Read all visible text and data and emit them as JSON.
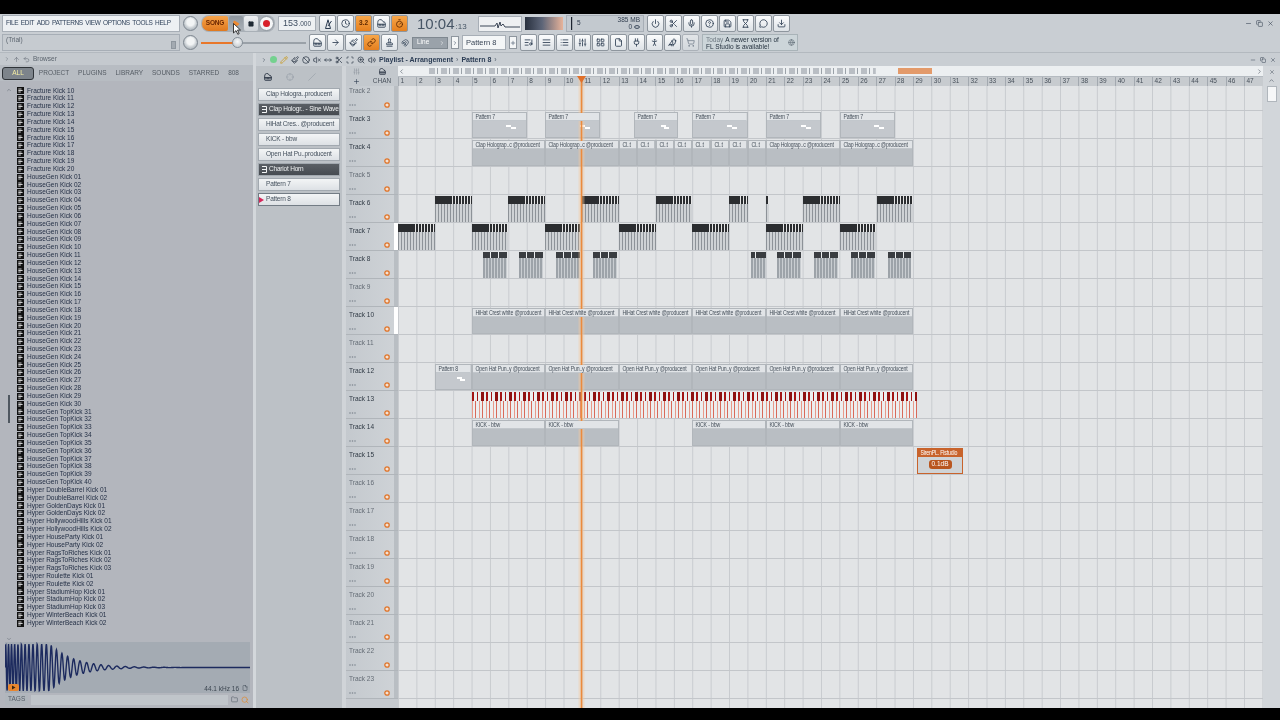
{
  "menu": [
    "FILE",
    "EDIT",
    "ADD",
    "PATTERNS",
    "VIEW",
    "OPTIONS",
    "TOOLS",
    "HELP"
  ],
  "hint_bar": {
    "text": "(Trial)"
  },
  "transport": {
    "mode": {
      "label": "SONG",
      "on": true
    },
    "playing": true,
    "tempo": "153",
    "tempo_decimals": ".000"
  },
  "record_options": [
    {
      "on": false
    },
    {
      "on": false
    },
    {
      "label": "3.2",
      "on": true
    },
    {
      "on": false
    },
    {
      "on": true
    }
  ],
  "clock": {
    "time": "10:04",
    "seconds": ":13"
  },
  "monitor": {
    "cpu": "5",
    "memory": "385 MB",
    "voices": "0"
  },
  "master_volume": {
    "level": 0.33
  },
  "tools": [
    {
      "on": false
    },
    {
      "on": false
    },
    {
      "on": false
    },
    {
      "on": true
    },
    {
      "on": false
    }
  ],
  "snap": {
    "value": "Line"
  },
  "pattern_selector": {
    "value": "Pattern 8"
  },
  "news": {
    "date": "Today",
    "message": "A newer version of FL Studio is available!"
  },
  "browser": {
    "title": "Browser",
    "tabs": [
      {
        "label": "ALL",
        "selected": true
      },
      {
        "label": "PROJECT",
        "selected": false
      },
      {
        "label": "PLUGINS",
        "selected": false
      },
      {
        "label": "LIBRARY",
        "selected": false
      },
      {
        "label": "SOUNDS",
        "selected": false
      },
      {
        "label": "STARRED",
        "selected": false
      },
      {
        "label": "808",
        "selected": false
      }
    ],
    "items": [
      "Fracture Kick 10",
      "Fracture Kick 11",
      "Fracture Kick 12",
      "Fracture Kick 13",
      "Fracture Kick 14",
      "Fracture Kick 15",
      "Fracture Kick 16",
      "Fracture Kick 17",
      "Fracture Kick 18",
      "Fracture Kick 19",
      "Fracture Kick 20",
      "HouseGen Kick 01",
      "HouseGen Kick 02",
      "HouseGen Kick 03",
      "HouseGen Kick 04",
      "HouseGen Kick 05",
      "HouseGen Kick 06",
      "HouseGen Kick 07",
      "HouseGen Kick 08",
      "HouseGen Kick 09",
      "HouseGen Kick 10",
      "HouseGen Kick 11",
      "HouseGen Kick 12",
      "HouseGen Kick 13",
      "HouseGen Kick 14",
      "HouseGen Kick 15",
      "HouseGen Kick 16",
      "HouseGen Kick 17",
      "HouseGen Kick 18",
      "HouseGen Kick 19",
      "HouseGen Kick 20",
      "HouseGen Kick 21",
      "HouseGen Kick 22",
      "HouseGen Kick 23",
      "HouseGen Kick 24",
      "HouseGen Kick 25",
      "HouseGen Kick 26",
      "HouseGen Kick 27",
      "HouseGen Kick 28",
      "HouseGen Kick 29",
      "HouseGen Kick 30",
      "HouseGen TopKick 31",
      "HouseGen TopKick 32",
      "HouseGen TopKick 33",
      "HouseGen TopKick 34",
      "HouseGen TopKick 35",
      "HouseGen TopKick 36",
      "HouseGen TopKick 37",
      "HouseGen TopKick 38",
      "HouseGen TopKick 39",
      "HouseGen TopKick 40",
      "Hyper DoubleBarrel Kick 01",
      "Hyper DoubleBarrel Kick 02",
      "Hyper GoldenDays Kick 01",
      "Hyper GoldenDays Kick 02",
      "Hyper HollywoodHills Kick 01",
      "Hyper HollywoodHills Kick 02",
      "Hyper HouseParty Kick 01",
      "Hyper HouseParty Kick 02",
      "Hyper RagsToRiches Kick 01",
      "Hyper RagsToRiches Kick 02",
      "Hyper RagsToRiches Kick 03",
      "Hyper Roulette Kick 01",
      "Hyper Roulette Kick 02",
      "Hyper StadiumHop Kick 01",
      "Hyper StadiumHop Kick 02",
      "Hyper StadiumHop Kick 03",
      "Hyper WinterBeach Kick 01",
      "Hyper WinterBeach Kick 02"
    ],
    "preview": {
      "info": "44.1 kHz 16"
    },
    "tags": "TAGS"
  },
  "playlist": {
    "breadcrumb": [
      {
        "kind": "label",
        "text": "Playlist - Arrangement"
      },
      {
        "kind": "separator",
        "text": "›"
      },
      {
        "kind": "label",
        "text": "Pattern 8"
      },
      {
        "kind": "separator",
        "text": "›"
      }
    ],
    "picker": [
      {
        "kind": "clip",
        "label": "Clap Hologra..producent",
        "selected": false
      },
      {
        "kind": "automation",
        "label": "Clap Hologr.. - Sine Wave",
        "selected": false
      },
      {
        "kind": "clip",
        "label": "HiHat Cres.. @producent",
        "selected": false
      },
      {
        "kind": "clip",
        "label": "KICK - bbw",
        "selected": false
      },
      {
        "kind": "clip",
        "label": "Open Hat Pu..producent",
        "selected": false
      },
      {
        "kind": "automation",
        "label": "Chariot Horn",
        "selected": false
      },
      {
        "kind": "pattern",
        "label": "Pattern 7",
        "selected": false
      },
      {
        "kind": "pattern",
        "label": "Pattern 8",
        "selected": true
      }
    ],
    "channel_label": "CHAN",
    "ruler": [
      "1",
      "2",
      "3",
      "4",
      "5",
      "6",
      "7",
      "8",
      "9",
      "10",
      "11",
      "12",
      "13",
      "14",
      "15",
      "16",
      "17",
      "18",
      "19",
      "20",
      "21",
      "22",
      "23",
      "24",
      "25",
      "26",
      "27",
      "28",
      "29",
      "30",
      "31",
      "32",
      "33",
      "34",
      "35",
      "36",
      "37",
      "38",
      "39",
      "40",
      "41",
      "42",
      "43",
      "44",
      "45",
      "46",
      "47"
    ],
    "playhead": {
      "level": 0.212
    },
    "tracks": [
      {
        "name": "Track 2",
        "empty": true,
        "selected": false
      },
      {
        "name": "Track 3",
        "empty": false,
        "selected": false,
        "clips": [
          {
            "kind": "pattern",
            "label": "Pattern 7"
          },
          {
            "kind": "pattern",
            "label": "Pattern 7"
          },
          {
            "kind": "pattern",
            "label": "Pattern 7"
          },
          {
            "kind": "pattern",
            "label": "Pattern 7"
          },
          {
            "kind": "pattern",
            "label": "Pattern 7"
          },
          {
            "kind": "pattern",
            "label": "Pattern 7"
          }
        ]
      },
      {
        "name": "Track 4",
        "empty": false,
        "selected": false,
        "clips": [
          {
            "kind": "audio",
            "label": "Clap Holograp..c @producent"
          },
          {
            "kind": "audio",
            "label": "Clap Holograp..c @producent"
          },
          {
            "kind": "audio",
            "label": "Cl..t"
          },
          {
            "kind": "audio",
            "label": "Cl..t"
          },
          {
            "kind": "audio",
            "label": "Cl..t"
          },
          {
            "kind": "audio",
            "label": "Cl..t"
          },
          {
            "kind": "audio",
            "label": "Cl..t"
          },
          {
            "kind": "audio",
            "label": "Cl..t"
          },
          {
            "kind": "audio",
            "label": "Cl..t"
          },
          {
            "kind": "audio",
            "label": "Cl..t"
          },
          {
            "kind": "audio",
            "label": "Clap Holograp..c @producent"
          },
          {
            "kind": "audio",
            "label": "Clap Holograp..c @producent"
          }
        ]
      },
      {
        "name": "Track 5",
        "empty": true,
        "selected": false
      },
      {
        "name": "Track 6",
        "empty": false,
        "selected": false,
        "clips": [
          {
            "kind": "notes"
          },
          {
            "kind": "notes"
          },
          {
            "kind": "notes"
          },
          {
            "kind": "notes"
          },
          {
            "kind": "notes"
          },
          {
            "kind": "notes"
          },
          {
            "kind": "notes"
          },
          {
            "kind": "notes"
          }
        ]
      },
      {
        "name": "Track 7",
        "empty": false,
        "selected": true,
        "clips": [
          {
            "kind": "notes"
          },
          {
            "kind": "notes"
          },
          {
            "kind": "notes"
          },
          {
            "kind": "notes"
          },
          {
            "kind": "notes"
          },
          {
            "kind": "notes"
          },
          {
            "kind": "notes"
          }
        ]
      },
      {
        "name": "Track 8",
        "empty": false,
        "selected": false,
        "clips": [
          {
            "kind": "chops"
          },
          {
            "kind": "chops"
          },
          {
            "kind": "chops"
          },
          {
            "kind": "chops"
          },
          {
            "kind": "chops"
          },
          {
            "kind": "chops"
          },
          {
            "kind": "chops"
          },
          {
            "kind": "chops"
          },
          {
            "kind": "chops"
          }
        ]
      },
      {
        "name": "Track 9",
        "empty": true,
        "selected": false
      },
      {
        "name": "Track 10",
        "empty": false,
        "selected": true,
        "clips": [
          {
            "kind": "audio",
            "label": "HiHat Crest white @producent"
          },
          {
            "kind": "audio",
            "label": "HiHat Crest white @producent"
          },
          {
            "kind": "audio",
            "label": "HiHat Crest white @producent"
          },
          {
            "kind": "audio",
            "label": "HiHat Crest white @producent"
          },
          {
            "kind": "audio",
            "label": "HiHat Crest white @producent"
          },
          {
            "kind": "audio",
            "label": "HiHat Crest white @producent"
          }
        ]
      },
      {
        "name": "Track 11",
        "empty": true,
        "selected": false
      },
      {
        "name": "Track 12",
        "empty": false,
        "selected": false,
        "clips": [
          {
            "kind": "pattern",
            "label": "Pattern 8"
          },
          {
            "kind": "audio",
            "label": "Open Hat Pun..y @producent"
          },
          {
            "kind": "audio",
            "label": "Open Hat Pun..y @producent"
          },
          {
            "kind": "audio",
            "label": "Open Hat Pun..y @producent"
          },
          {
            "kind": "audio",
            "label": "Open Hat Pun..y @producent"
          },
          {
            "kind": "audio",
            "label": "Open Hat Pun..y @producent"
          },
          {
            "kind": "audio",
            "label": "Open Hat Pun..y @producent"
          }
        ]
      },
      {
        "name": "Track 13",
        "empty": false,
        "selected": false,
        "clips": [
          {
            "kind": "melody"
          }
        ]
      },
      {
        "name": "Track 14",
        "empty": false,
        "selected": false,
        "clips": [
          {
            "kind": "audio",
            "label": "KICK - bbw"
          },
          {
            "kind": "audio",
            "label": "KICK - bbw"
          },
          {
            "kind": "audio",
            "label": "KICK - bbw"
          },
          {
            "kind": "audio",
            "label": "KICK - bbw"
          },
          {
            "kind": "audio",
            "label": "KICK - bbw"
          }
        ]
      },
      {
        "name": "Track 15",
        "empty": false,
        "selected": false,
        "clips": [
          {
            "kind": "sample",
            "label": "SirenPL. Flstudio",
            "value": "0.1dB"
          }
        ]
      },
      {
        "name": "Track 16",
        "empty": true,
        "selected": false
      },
      {
        "name": "Track 17",
        "empty": true,
        "selected": false
      },
      {
        "name": "Track 18",
        "empty": true,
        "selected": false
      },
      {
        "name": "Track 19",
        "empty": true,
        "selected": false
      },
      {
        "name": "Track 20",
        "empty": true,
        "selected": false
      },
      {
        "name": "Track 21",
        "empty": true,
        "selected": false
      },
      {
        "name": "Track 22",
        "empty": true,
        "selected": false
      },
      {
        "name": "Track 23",
        "empty": true,
        "selected": false
      }
    ]
  }
}
